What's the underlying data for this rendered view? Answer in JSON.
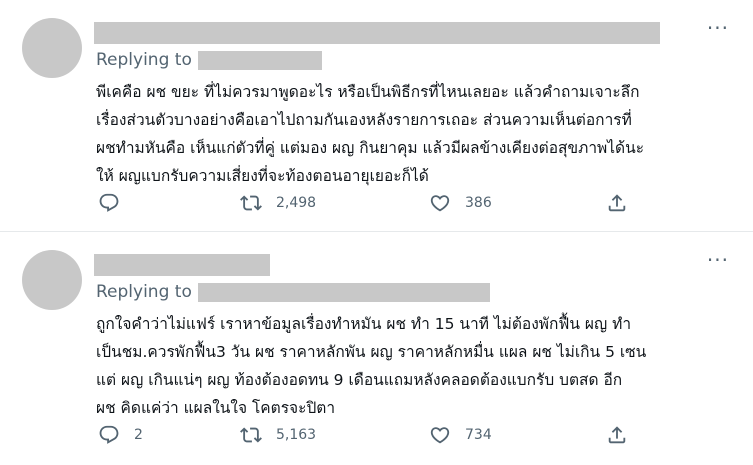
{
  "tweets": [
    {
      "replying_to": "Replying to",
      "text_lines": [
        "พีเคคือ ผช ขยะ ที่ไม่ควรมาพูดอะไร หรือเป็นพิธีกรที่ไหนเลยอะ แล้วคำถามเจาะลึก",
        "เรื่องส่วนตัวบางอย่างคือเอาไปถามกันเองหลังรายการเถอะ ส่วนความเห็นต่อการที่",
        "ผชทำมหันคือ เห็นแก่ตัวที่คู่ แต่มอง ผญ กินยาคุม แล้วมีผลข้างเคียงต่อสุขภาพได้นะ",
        "ให้ ผญแบกรับความเสี่ยงที่จะท้องตอนอายุเยอะก็ได้"
      ],
      "reply_count": "",
      "retweet_count": "2,498",
      "like_count": "386"
    },
    {
      "replying_to": "Replying to",
      "text_lines": [
        "ถูกใจคำว่าไม่แฟร์ เราหาข้อมูลเรื่องทำหมัน ผช ทำ 15 นาที ไม่ต้องพักฟื้น ผญ ทำ",
        "เป็นชม.ควรพักฟื้น3 วัน ผช ราคาหลักพัน ผญ ราคาหลักหมื่น แผล ผช ไม่เกิน 5 เซน",
        "แต่ ผญ เกินแน่ๆ ผญ ท้องต้องอดทน 9 เดือนแถมหลังคลอดต้องแบกรับ บตสด อีก",
        "ผช คิดแค่ว่า แผลในใจ โคตรจะปิตา"
      ],
      "reply_count": "2",
      "retweet_count": "5,163",
      "like_count": "734"
    }
  ],
  "icons": {
    "reply": "reply-icon",
    "retweet": "retweet-icon",
    "like": "heart-icon",
    "share": "share-icon",
    "more": "more-icon"
  },
  "colors": {
    "text": "#0f1419",
    "secondary": "#536471",
    "redacted": "#c8c8c8",
    "divider": "#e6e9eb"
  }
}
